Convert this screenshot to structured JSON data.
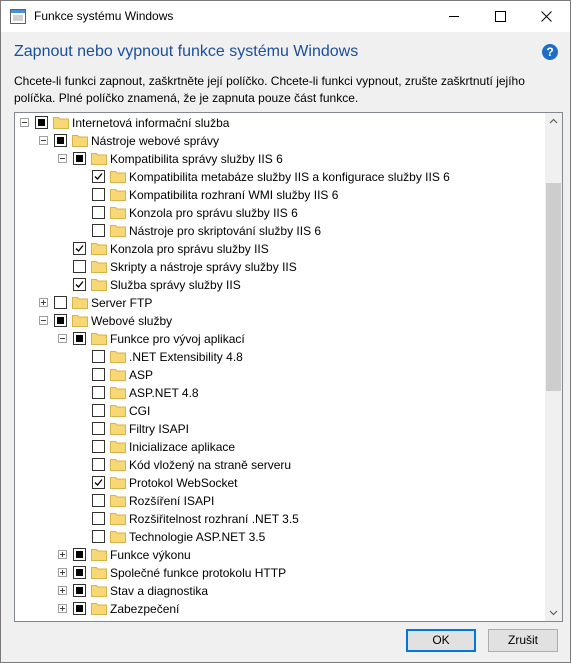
{
  "window": {
    "title": "Funkce systému Windows",
    "heading": "Zapnout nebo vypnout funkce systému Windows",
    "description": "Chcete-li funkci zapnout, zaškrtněte její políčko. Chcete-li funkci vypnout, zrušte zaškrtnutí jejího políčka. Plné políčko znamená, že je zapnuta pouze část funkce.",
    "help_glyph": "?"
  },
  "tree": [
    {
      "label": "Internetová informační služba",
      "level": 0,
      "expander": "minus",
      "state": "partial"
    },
    {
      "label": "Nástroje webové správy",
      "level": 1,
      "expander": "minus",
      "state": "partial"
    },
    {
      "label": "Kompatibilita správy služby IIS 6",
      "level": 2,
      "expander": "minus",
      "state": "partial"
    },
    {
      "label": "Kompatibilita metabáze služby IIS a konfigurace služby IIS 6",
      "level": 3,
      "expander": "none",
      "state": "checked"
    },
    {
      "label": "Kompatibilita rozhraní WMI služby IIS 6",
      "level": 3,
      "expander": "none",
      "state": "unchecked"
    },
    {
      "label": "Konzola pro správu služby IIS 6",
      "level": 3,
      "expander": "none",
      "state": "unchecked"
    },
    {
      "label": "Nástroje pro skriptování služby IIS 6",
      "level": 3,
      "expander": "none",
      "state": "unchecked"
    },
    {
      "label": "Konzola pro správu služby IIS",
      "level": 2,
      "expander": "none",
      "state": "checked"
    },
    {
      "label": "Skripty a nástroje správy služby IIS",
      "level": 2,
      "expander": "none",
      "state": "unchecked"
    },
    {
      "label": "Služba správy služby IIS",
      "level": 2,
      "expander": "none",
      "state": "checked"
    },
    {
      "label": "Server FTP",
      "level": 1,
      "expander": "plus",
      "state": "unchecked"
    },
    {
      "label": "Webové služby",
      "level": 1,
      "expander": "minus",
      "state": "partial"
    },
    {
      "label": "Funkce pro vývoj aplikací",
      "level": 2,
      "expander": "minus",
      "state": "partial"
    },
    {
      "label": ".NET Extensibility 4.8",
      "level": 3,
      "expander": "none",
      "state": "unchecked"
    },
    {
      "label": "ASP",
      "level": 3,
      "expander": "none",
      "state": "unchecked"
    },
    {
      "label": "ASP.NET 4.8",
      "level": 3,
      "expander": "none",
      "state": "unchecked"
    },
    {
      "label": "CGI",
      "level": 3,
      "expander": "none",
      "state": "unchecked"
    },
    {
      "label": "Filtry ISAPI",
      "level": 3,
      "expander": "none",
      "state": "unchecked"
    },
    {
      "label": "Inicializace aplikace",
      "level": 3,
      "expander": "none",
      "state": "unchecked"
    },
    {
      "label": "Kód vložený na straně serveru",
      "level": 3,
      "expander": "none",
      "state": "unchecked"
    },
    {
      "label": "Protokol WebSocket",
      "level": 3,
      "expander": "none",
      "state": "checked"
    },
    {
      "label": "Rozšíření ISAPI",
      "level": 3,
      "expander": "none",
      "state": "unchecked"
    },
    {
      "label": "Rozšiřitelnost rozhraní .NET 3.5",
      "level": 3,
      "expander": "none",
      "state": "unchecked"
    },
    {
      "label": "Technologie ASP.NET 3.5",
      "level": 3,
      "expander": "none",
      "state": "unchecked"
    },
    {
      "label": "Funkce výkonu",
      "level": 2,
      "expander": "plus",
      "state": "partial"
    },
    {
      "label": "Společné funkce protokolu HTTP",
      "level": 2,
      "expander": "plus",
      "state": "partial"
    },
    {
      "label": "Stav a diagnostika",
      "level": 2,
      "expander": "plus",
      "state": "partial"
    },
    {
      "label": "Zabezpečení",
      "level": 2,
      "expander": "plus",
      "state": "partial"
    }
  ],
  "buttons": {
    "ok": "OK",
    "cancel": "Zrušit"
  },
  "colors": {
    "heading": "#1a4f9c",
    "help": "#1e6ec8",
    "folder": "#f8d775",
    "focus": "#0078d7"
  },
  "icons": {
    "minimize": "minimize-icon",
    "maximize": "maximize-icon",
    "close": "close-icon",
    "folder": "folder-icon"
  }
}
